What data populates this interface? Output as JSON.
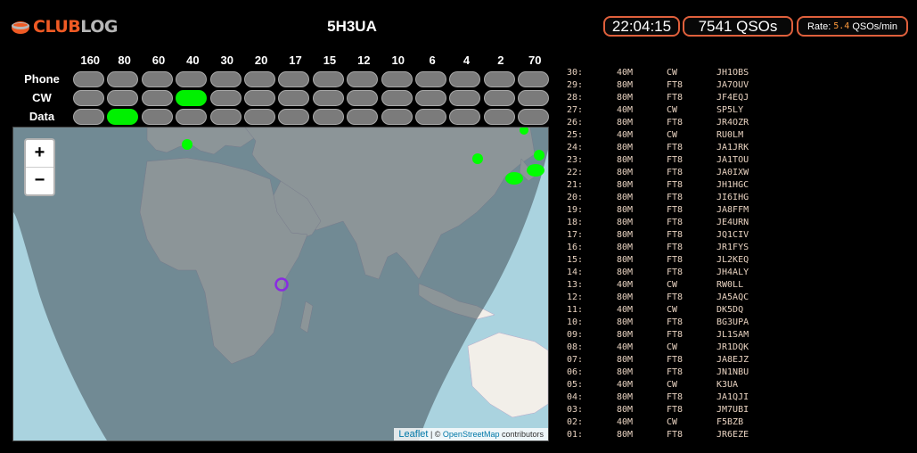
{
  "brand": {
    "part1": "CLUB",
    "part2": "LOG"
  },
  "callsign": "5H3UA",
  "clock": "22:04:15",
  "qso_count": "7541 QSOs",
  "rate": {
    "label": "Rate:",
    "value": "5.4",
    "unit": "QSOs/min"
  },
  "bands": [
    "160",
    "80",
    "60",
    "40",
    "30",
    "20",
    "17",
    "15",
    "12",
    "10",
    "6",
    "4",
    "2",
    "70"
  ],
  "modes": [
    {
      "label": "Phone",
      "active": []
    },
    {
      "label": "CW",
      "active": [
        "40"
      ]
    },
    {
      "label": "Data",
      "active": [
        "80"
      ]
    }
  ],
  "map": {
    "zoom_in": "+",
    "zoom_out": "−",
    "attribution": {
      "leaflet": "Leaflet",
      "sep": " | © ",
      "osm": "OpenStreetMap",
      "rest": " contributors"
    }
  },
  "log": [
    {
      "num": "30:",
      "band": "40M",
      "mode": "CW",
      "call": "JH1OBS"
    },
    {
      "num": "29:",
      "band": "80M",
      "mode": "FT8",
      "call": "JA7OUV"
    },
    {
      "num": "28:",
      "band": "80M",
      "mode": "FT8",
      "call": "JF4EQJ"
    },
    {
      "num": "27:",
      "band": "40M",
      "mode": "CW",
      "call": "SP5LY"
    },
    {
      "num": "26:",
      "band": "80M",
      "mode": "FT8",
      "call": "JR4OZR"
    },
    {
      "num": "25:",
      "band": "40M",
      "mode": "CW",
      "call": "RU0LM"
    },
    {
      "num": "24:",
      "band": "80M",
      "mode": "FT8",
      "call": "JA1JRK"
    },
    {
      "num": "23:",
      "band": "80M",
      "mode": "FT8",
      "call": "JA1TOU"
    },
    {
      "num": "22:",
      "band": "80M",
      "mode": "FT8",
      "call": "JA0IXW"
    },
    {
      "num": "21:",
      "band": "80M",
      "mode": "FT8",
      "call": "JH1HGC"
    },
    {
      "num": "20:",
      "band": "80M",
      "mode": "FT8",
      "call": "JI6IHG"
    },
    {
      "num": "19:",
      "band": "80M",
      "mode": "FT8",
      "call": "JA8FFM"
    },
    {
      "num": "18:",
      "band": "80M",
      "mode": "FT8",
      "call": "JE4URN"
    },
    {
      "num": "17:",
      "band": "80M",
      "mode": "FT8",
      "call": "JQ1CIV"
    },
    {
      "num": "16:",
      "band": "80M",
      "mode": "FT8",
      "call": "JR1FYS"
    },
    {
      "num": "15:",
      "band": "80M",
      "mode": "FT8",
      "call": "JL2KEQ"
    },
    {
      "num": "14:",
      "band": "80M",
      "mode": "FT8",
      "call": "JH4ALY"
    },
    {
      "num": "13:",
      "band": "40M",
      "mode": "CW",
      "call": "RW0LL"
    },
    {
      "num": "12:",
      "band": "80M",
      "mode": "FT8",
      "call": "JA5AQC"
    },
    {
      "num": "11:",
      "band": "40M",
      "mode": "CW",
      "call": "DK5DQ"
    },
    {
      "num": "10:",
      "band": "80M",
      "mode": "FT8",
      "call": "BG3UPA"
    },
    {
      "num": "09:",
      "band": "80M",
      "mode": "FT8",
      "call": "JL1SAM"
    },
    {
      "num": "08:",
      "band": "40M",
      "mode": "CW",
      "call": "JR1DQK"
    },
    {
      "num": "07:",
      "band": "80M",
      "mode": "FT8",
      "call": "JA8EJZ"
    },
    {
      "num": "06:",
      "band": "80M",
      "mode": "FT8",
      "call": "JN1NBU"
    },
    {
      "num": "05:",
      "band": "40M",
      "mode": "CW",
      "call": "K3UA"
    },
    {
      "num": "04:",
      "band": "80M",
      "mode": "FT8",
      "call": "JA1QJI"
    },
    {
      "num": "03:",
      "band": "80M",
      "mode": "FT8",
      "call": "JM7UBI"
    },
    {
      "num": "02:",
      "band": "40M",
      "mode": "CW",
      "call": "F5BZB"
    },
    {
      "num": "01:",
      "band": "80M",
      "mode": "FT8",
      "call": "JR6EZE"
    }
  ],
  "colors": {
    "accent": "#e0603c",
    "active": "#00f000",
    "inactive": "#7b7b7b",
    "log_text": "#e8d2c0"
  }
}
